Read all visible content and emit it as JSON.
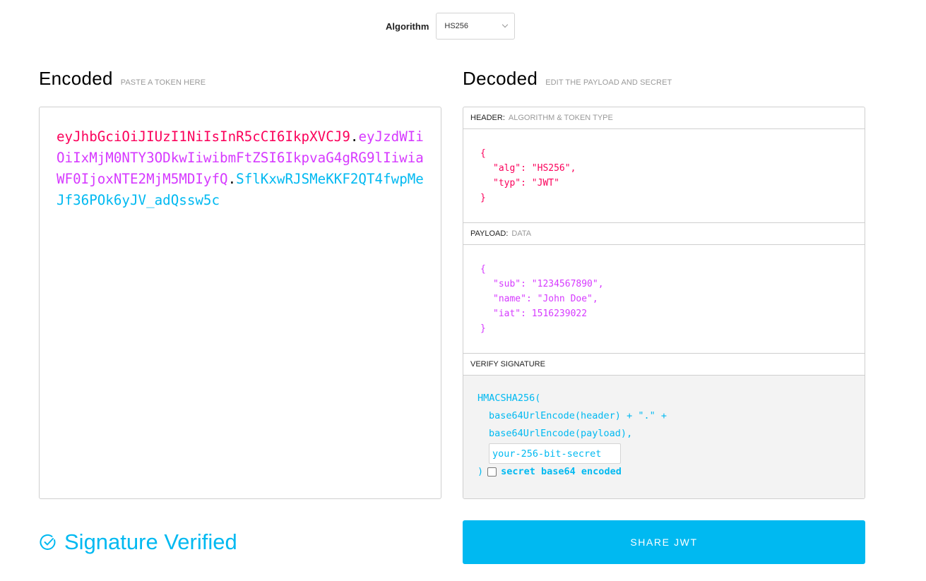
{
  "algorithm": {
    "label": "Algorithm",
    "selected": "HS256"
  },
  "encoded": {
    "title": "Encoded",
    "hint": "PASTE A TOKEN HERE",
    "token": {
      "header": "eyJhbGciOiJIUzI1NiIsInR5cCI6IkpXVCJ9",
      "payload": "eyJzdWIiOiIxMjM0NTY3ODkwIiwibmFtZSI6IkpvaG4gRG9lIiwiaWF0IjoxNTE2MjM5MDIyfQ",
      "signature": "SflKxwRJSMeKKF2QT4fwpMeJf36POk6yJV_adQssw5c",
      "separator": "."
    }
  },
  "decoded": {
    "title": "Decoded",
    "hint": "EDIT THE PAYLOAD AND SECRET",
    "header_panel": {
      "label": "HEADER:",
      "hint": "ALGORITHM & TOKEN TYPE",
      "open": "{",
      "lines": [
        "\"alg\": \"HS256\",",
        "\"typ\": \"JWT\""
      ],
      "close": "}"
    },
    "payload_panel": {
      "label": "PAYLOAD:",
      "hint": "DATA",
      "open": "{",
      "lines": [
        "\"sub\": \"1234567890\",",
        "\"name\": \"John Doe\",",
        "\"iat\": 1516239022"
      ],
      "close": "}"
    },
    "signature_panel": {
      "label": "VERIFY SIGNATURE",
      "fn": "HMACSHA256(",
      "line1": "base64UrlEncode(header) + \".\" +",
      "line2": "base64UrlEncode(payload),",
      "secret_placeholder": "your-256-bit-secret",
      "close": ")",
      "checkbox_label": "secret base64 encoded",
      "checkbox_checked": false
    }
  },
  "status": {
    "text": "Signature Verified",
    "color": "#00b9f1"
  },
  "share_button": {
    "label": "SHARE JWT",
    "color": "#00b9f1"
  },
  "colors": {
    "header": "#fb015b",
    "payload": "#d63aff",
    "signature": "#00b9f1"
  }
}
